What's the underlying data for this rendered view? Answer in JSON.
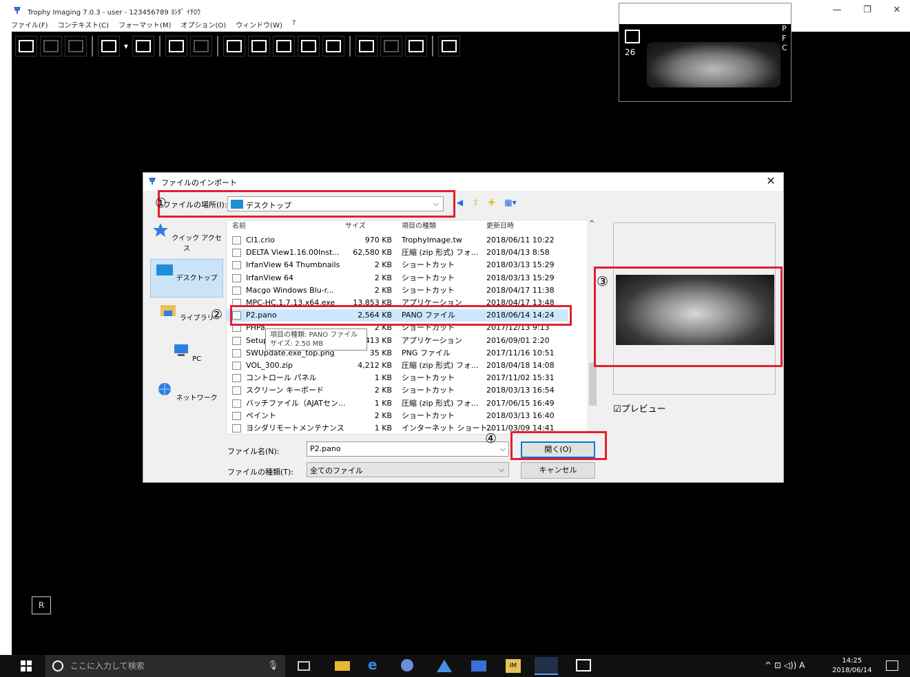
{
  "app": {
    "title": "Trophy Imaging 7.0.3 - user - 123456789 ﾖｼﾀﾞ ｲﾁﾛｳ",
    "window_controls": [
      "—",
      "❐",
      "✕"
    ]
  },
  "menu": [
    "ファイル(F)",
    "コンテキスト(C)",
    "フォーマット(M)",
    "オプション(O)",
    "ウィンドウ(W)",
    "?"
  ],
  "thumbnail": {
    "number": "26",
    "labels": [
      "P",
      "F",
      "C"
    ]
  },
  "marker": "R",
  "dialog": {
    "title": "ファイルのインポート",
    "look_in_label": "ファイルの場所(I):",
    "look_in_value": "デスクトップ",
    "places": [
      "クイック アクセス",
      "デスクトップ",
      "ライブラリ",
      "PC",
      "ネットワーク"
    ],
    "columns": [
      "名前",
      "サイズ",
      "項目の種類",
      "更新日時"
    ],
    "files": [
      {
        "name": "CI1.crio",
        "size": "970 KB",
        "kind": "TrophyImage.tw",
        "date": "2018/06/11 10:22"
      },
      {
        "name": "DELTA View1.16.00Inst...",
        "size": "62,580 KB",
        "kind": "圧縮 (zip 形式) フォ...",
        "date": "2018/04/13 8:58"
      },
      {
        "name": "IrfanView 64 Thumbnails",
        "size": "2 KB",
        "kind": "ショートカット",
        "date": "2018/03/13 15:29"
      },
      {
        "name": "IrfanView 64",
        "size": "2 KB",
        "kind": "ショートカット",
        "date": "2018/03/13 15:29"
      },
      {
        "name": "Macgo Windows Blu-r...",
        "size": "2 KB",
        "kind": "ショートカット",
        "date": "2018/04/17 11:38"
      },
      {
        "name": "MPC-HC.1.7.13.x64.exe",
        "size": "13,853 KB",
        "kind": "アプリケーション",
        "date": "2018/04/17 13:48"
      },
      {
        "name": "P2.pano",
        "size": "2,564 KB",
        "kind": "PANO ファイル",
        "date": "2018/06/14 14:24"
      },
      {
        "name": "PHPa...",
        "size": "2 KB",
        "kind": "ショートカット",
        "date": "2017/12/13 9:13"
      },
      {
        "name": "Setup",
        "size": "413 KB",
        "kind": "アプリケーション",
        "date": "2016/09/01 2:20"
      },
      {
        "name": "SWUpdate.exe_top.png",
        "size": "35 KB",
        "kind": "PNG ファイル",
        "date": "2017/11/16 10:51"
      },
      {
        "name": "VOL_300.zip",
        "size": "4,212 KB",
        "kind": "圧縮 (zip 形式) フォ...",
        "date": "2018/04/18 14:08"
      },
      {
        "name": "コントロール パネル",
        "size": "1 KB",
        "kind": "ショートカット",
        "date": "2017/11/02 15:31"
      },
      {
        "name": "スクリーン キーボード",
        "size": "2 KB",
        "kind": "ショートカット",
        "date": "2018/03/13 16:54"
      },
      {
        "name": "バッチファイル（AJATセン...",
        "size": "1 KB",
        "kind": "圧縮 (zip 形式) フォ...",
        "date": "2017/06/15 16:49"
      },
      {
        "name": "ペイント",
        "size": "2 KB",
        "kind": "ショートカット",
        "date": "2018/03/13 16:40"
      },
      {
        "name": "ヨシダリモートメンテナンス",
        "size": "1 KB",
        "kind": "インターネット ショート...",
        "date": "2011/03/09 14:41"
      }
    ],
    "tooltip_type": "項目の種類: PANO ファイル",
    "tooltip_size": "サイズ: 2.50 MB",
    "preview_label": "☑プレビュー",
    "filename_label": "ファイル名(N):",
    "filename_value": "P2.pano",
    "filetype_label": "ファイルの種類(T):",
    "filetype_value": "全てのファイル",
    "open_label": "開く(O)",
    "cancel_label": "キャンセル"
  },
  "annotations": [
    "①",
    "②",
    "③",
    "④"
  ],
  "taskbar": {
    "search_placeholder": "ここに入力して検索",
    "time": "14:25",
    "date": "2018/06/14",
    "tray": "^ ⊡ ◁)) A"
  },
  "colors": {
    "accent": "#0078d7",
    "annotation": "#e0202e",
    "selection": "#cce8ff"
  }
}
